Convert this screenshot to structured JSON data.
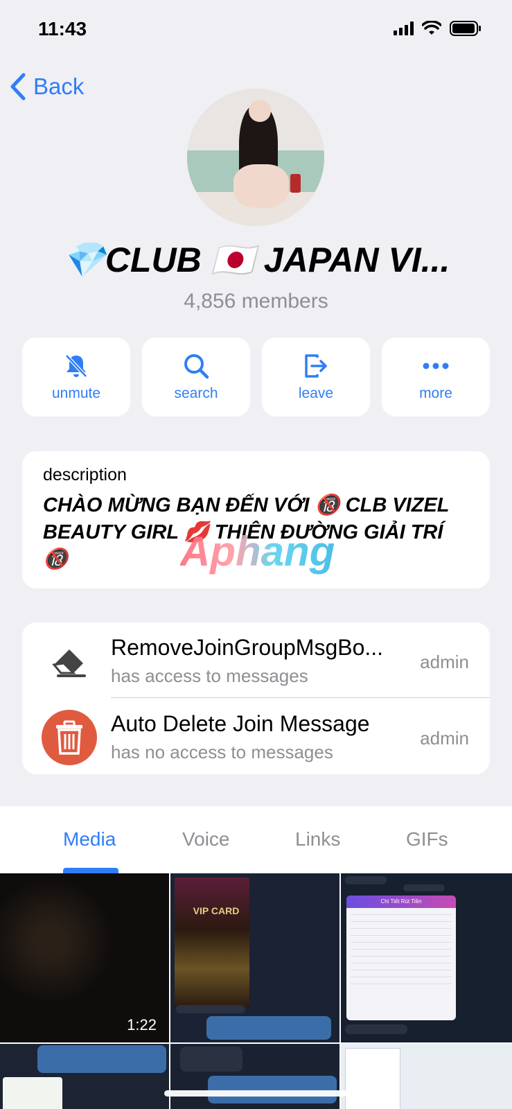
{
  "status_bar": {
    "time": "11:43"
  },
  "nav": {
    "back_label": "Back"
  },
  "group": {
    "title": "💎CLUB 🇯🇵 JAPAN VI...",
    "members": "4,856 members"
  },
  "actions": [
    {
      "label": "unmute",
      "icon": "bell-slash-icon"
    },
    {
      "label": "search",
      "icon": "search-icon"
    },
    {
      "label": "leave",
      "icon": "leave-icon"
    },
    {
      "label": "more",
      "icon": "more-icon"
    }
  ],
  "description": {
    "label": "description",
    "text": "CHÀO MỪNG BẠN ĐẾN VỚI 🔞 CLB VIZEL BEAUTY GIRL 💋 THIÊN ĐƯỜNG GIẢI TRÍ 🔞",
    "watermark": "Aphang"
  },
  "bots": [
    {
      "name": "RemoveJoinGroupMsgBo...",
      "access": "has access to messages",
      "role": "admin",
      "icon": "eraser-icon"
    },
    {
      "name": "Auto Delete Join Message",
      "access": "has no access to messages",
      "role": "admin",
      "icon": "trash-icon"
    }
  ],
  "tabs": [
    {
      "label": "Media",
      "active": true
    },
    {
      "label": "Voice",
      "active": false
    },
    {
      "label": "Links",
      "active": false
    },
    {
      "label": "GIFs",
      "active": false
    }
  ],
  "media": {
    "video_duration": "1:22",
    "vip_card_label": "VIP CARD",
    "withdraw_title": "Chi Tiết Rút Tiền"
  },
  "colors": {
    "accent": "#2f7ef6",
    "background": "#efeff4",
    "secondary_text": "#8e8e93",
    "trash_bg": "#e05a3f"
  }
}
